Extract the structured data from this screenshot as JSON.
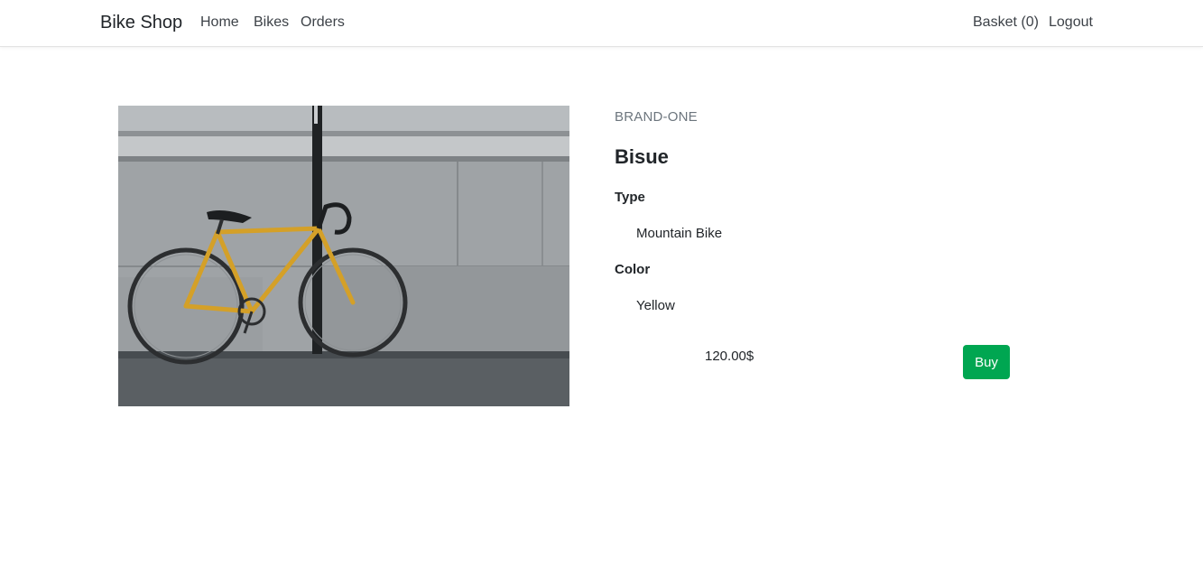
{
  "navbar": {
    "brand": "Bike Shop",
    "links": [
      "Home",
      "Bikes",
      "Orders"
    ],
    "basket": "Basket (0)",
    "logout": "Logout"
  },
  "product": {
    "brand": "BRAND-ONE",
    "name": "Bisue",
    "type_label": "Type",
    "type_value": "Mountain Bike",
    "color_label": "Color",
    "color_value": "Yellow",
    "price": "120.00$",
    "buy_label": "Buy",
    "image_icon": "bicycle-photo"
  },
  "colors": {
    "buy_button": "#00a651",
    "brand_text": "#6c757d"
  }
}
